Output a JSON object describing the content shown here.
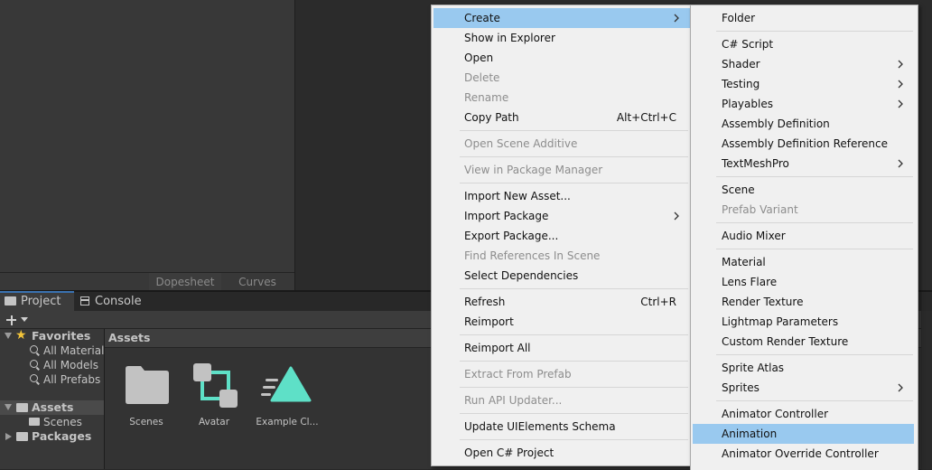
{
  "animation_window": {
    "tabs": [
      "Dopesheet",
      "Curves"
    ]
  },
  "project_window": {
    "tabs": {
      "project": "Project",
      "console": "Console"
    },
    "breadcrumb": "Assets",
    "tree": {
      "favorites": "Favorites",
      "all_materials": "All Materials",
      "all_models": "All Models",
      "all_prefabs": "All Prefabs",
      "assets": "Assets",
      "scenes": "Scenes",
      "packages": "Packages"
    },
    "assets": [
      {
        "label": "Scenes",
        "icon": "folder-icon"
      },
      {
        "label": "Avatar",
        "icon": "avatar-icon"
      },
      {
        "label": "Example Cl...",
        "icon": "animation-clip-icon"
      }
    ]
  },
  "context_menu": {
    "items": [
      {
        "label": "Create",
        "submenu": true,
        "highlighted": true
      },
      {
        "label": "Show in Explorer"
      },
      {
        "label": "Open"
      },
      {
        "label": "Delete",
        "disabled": true
      },
      {
        "label": "Rename",
        "disabled": true
      },
      {
        "label": "Copy Path",
        "shortcut": "Alt+Ctrl+C"
      },
      {
        "label": "Open Scene Additive",
        "disabled": true
      },
      {
        "label": "View in Package Manager",
        "disabled": true
      },
      {
        "label": "Import New Asset..."
      },
      {
        "label": "Import Package",
        "submenu": true
      },
      {
        "label": "Export Package..."
      },
      {
        "label": "Find References In Scene",
        "disabled": true
      },
      {
        "label": "Select Dependencies"
      },
      {
        "label": "Refresh",
        "shortcut": "Ctrl+R"
      },
      {
        "label": "Reimport"
      },
      {
        "label": "Reimport All"
      },
      {
        "label": "Extract From Prefab",
        "disabled": true
      },
      {
        "label": "Run API Updater...",
        "disabled": true
      },
      {
        "label": "Update UIElements Schema"
      },
      {
        "label": "Open C# Project"
      }
    ]
  },
  "create_submenu": {
    "items": [
      {
        "label": "Folder"
      },
      {
        "label": "C# Script"
      },
      {
        "label": "Shader",
        "submenu": true
      },
      {
        "label": "Testing",
        "submenu": true
      },
      {
        "label": "Playables",
        "submenu": true
      },
      {
        "label": "Assembly Definition"
      },
      {
        "label": "Assembly Definition Reference"
      },
      {
        "label": "TextMeshPro",
        "submenu": true
      },
      {
        "label": "Scene"
      },
      {
        "label": "Prefab Variant",
        "disabled": true
      },
      {
        "label": "Audio Mixer"
      },
      {
        "label": "Material"
      },
      {
        "label": "Lens Flare"
      },
      {
        "label": "Render Texture"
      },
      {
        "label": "Lightmap Parameters"
      },
      {
        "label": "Custom Render Texture"
      },
      {
        "label": "Sprite Atlas"
      },
      {
        "label": "Sprites",
        "submenu": true
      },
      {
        "label": "Animator Controller"
      },
      {
        "label": "Animation",
        "highlighted": true
      },
      {
        "label": "Animator Override Controller"
      }
    ]
  },
  "colors": {
    "menu_highlight": "#99c9ef",
    "menu_background": "#f0f0f0",
    "accent_teal": "#5ee0c7",
    "favorite_star": "#f2c43a"
  }
}
